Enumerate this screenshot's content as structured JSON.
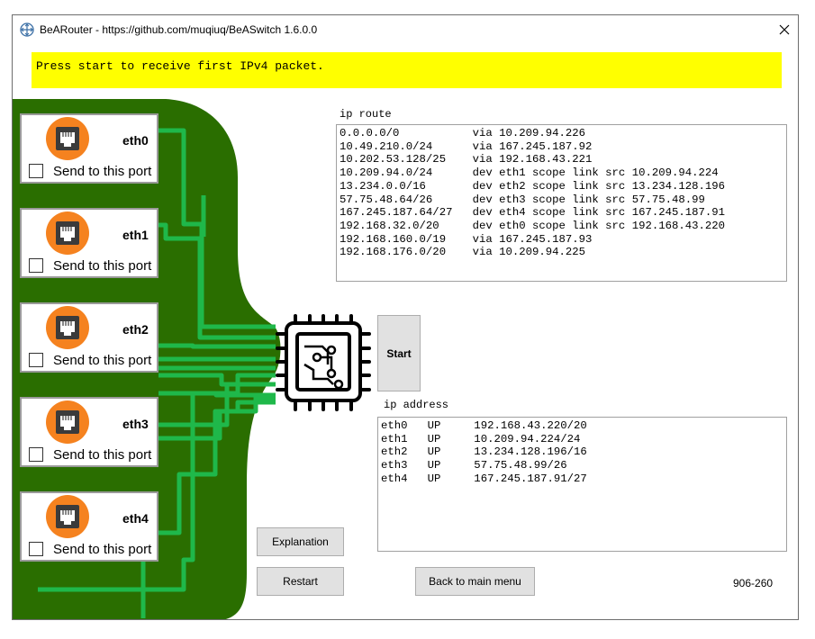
{
  "window": {
    "title": "BeARouter - https://github.com/muqiuq/BeASwitch 1.6.0.0"
  },
  "status": {
    "message": "Press start to receive first IPv4 packet."
  },
  "ports": [
    {
      "name": "eth0",
      "checkbox_label": "Send to this port",
      "checked": false
    },
    {
      "name": "eth1",
      "checkbox_label": "Send to this port",
      "checked": false
    },
    {
      "name": "eth2",
      "checkbox_label": "Send to this port",
      "checked": false
    },
    {
      "name": "eth3",
      "checkbox_label": "Send to this port",
      "checked": false
    },
    {
      "name": "eth4",
      "checkbox_label": "Send to this port",
      "checked": false
    }
  ],
  "ip_route": {
    "label": "ip route",
    "content": "0.0.0.0/0           via 10.209.94.226\n10.49.210.0/24      via 167.245.187.92\n10.202.53.128/25    via 192.168.43.221\n10.209.94.0/24      dev eth1 scope link src 10.209.94.224\n13.234.0.0/16       dev eth2 scope link src 13.234.128.196\n57.75.48.64/26      dev eth3 scope link src 57.75.48.99\n167.245.187.64/27   dev eth4 scope link src 167.245.187.91\n192.168.32.0/20     dev eth0 scope link src 192.168.43.220\n192.168.160.0/19    via 167.245.187.93\n192.168.176.0/20    via 10.209.94.225"
  },
  "ip_address": {
    "label": "ip address",
    "content": "eth0   UP     192.168.43.220/20\neth1   UP     10.209.94.224/24\neth2   UP     13.234.128.196/16\neth3   UP     57.75.48.99/26\neth4   UP     167.245.187.91/27"
  },
  "buttons": {
    "start": "Start",
    "explanation": "Explanation",
    "restart": "Restart",
    "back": "Back to main menu"
  },
  "corner_code": "906-260",
  "icons": {
    "app": "network-icon",
    "close": "close-icon",
    "port": "ethernet-port-icon",
    "router": "cpu-chip-icon"
  },
  "colors": {
    "board": "#2a6e00",
    "trace": "#1fb84a",
    "status_bg": "#ffff00",
    "port_icon_bg": "#f5821f"
  }
}
